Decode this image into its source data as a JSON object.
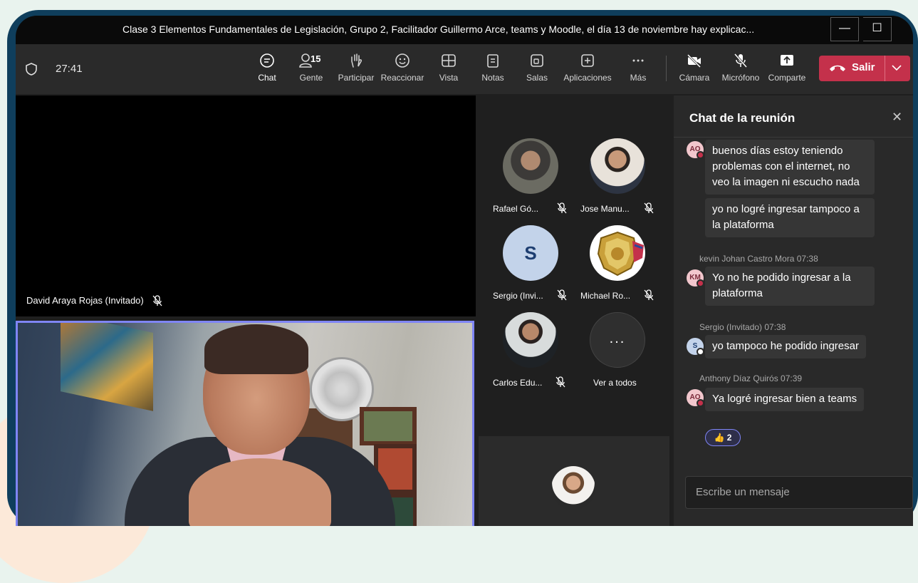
{
  "window": {
    "title": "Clase 3 Elementos Fundamentales de Legislación,  Grupo 2, Facilitador Guillermo Arce, teams y Moodle, el día 13 de noviembre hay explicac...",
    "minimize": "—",
    "maximize": "☐"
  },
  "toolbar": {
    "timer": "27:41",
    "buttons": [
      {
        "label": "Chat",
        "icon": "chat-icon"
      },
      {
        "label": "Gente",
        "icon": "people-icon",
        "count": "15"
      },
      {
        "label": "Participar",
        "icon": "raise-hand-icon"
      },
      {
        "label": "Reaccionar",
        "icon": "smiley-icon"
      },
      {
        "label": "Vista",
        "icon": "view-icon"
      },
      {
        "label": "Notas",
        "icon": "notes-icon"
      },
      {
        "label": "Salas",
        "icon": "rooms-icon"
      },
      {
        "label": "Aplicaciones",
        "icon": "apps-icon"
      },
      {
        "label": "Más",
        "icon": "more-icon"
      },
      {
        "label": "Cámara",
        "icon": "camera-off-icon"
      },
      {
        "label": "Micrófono",
        "icon": "mic-off-icon"
      },
      {
        "label": "Comparte",
        "icon": "share-icon"
      }
    ],
    "leave_label": "Salir"
  },
  "stage": {
    "top_name": "David Araya Rojas (Invitado)"
  },
  "gallery": {
    "participants": [
      {
        "name": "Rafael Gó..."
      },
      {
        "name": "Jose Manu..."
      },
      {
        "name": "Sergio (Invi...",
        "initial": "S"
      },
      {
        "name": "Michael Ro..."
      },
      {
        "name": "Carlos Edu..."
      },
      {
        "name": "Ver a todos",
        "more": "..."
      }
    ]
  },
  "chat": {
    "header": "Chat de la reunión",
    "close": "✕",
    "messages": [
      {
        "initials": "AO",
        "text": "buenos días estoy teniendo problemas con el internet, no veo la imagen ni escucho nada"
      },
      {
        "text": "yo no logré ingresar tampoco a la plataforma"
      },
      {
        "meta": "kevin Johan Castro Mora  07:38",
        "initials": "KM",
        "text": "Yo no he podido ingresar a la plataforma"
      },
      {
        "meta": "Sergio (Invitado)  07:38",
        "initials": "S",
        "text": "yo tampoco he podido ingresar"
      },
      {
        "meta": "Anthony Díaz Quirós  07:39",
        "initials": "AO",
        "text": "Ya logré ingresar bien a teams"
      }
    ],
    "reaction": {
      "emoji": "👍",
      "count": "2"
    },
    "compose_placeholder": "Escribe un mensaje"
  },
  "colors": {
    "accent": "#7f85f5",
    "leave": "#c4314b",
    "frame": "#0f3e5c"
  }
}
